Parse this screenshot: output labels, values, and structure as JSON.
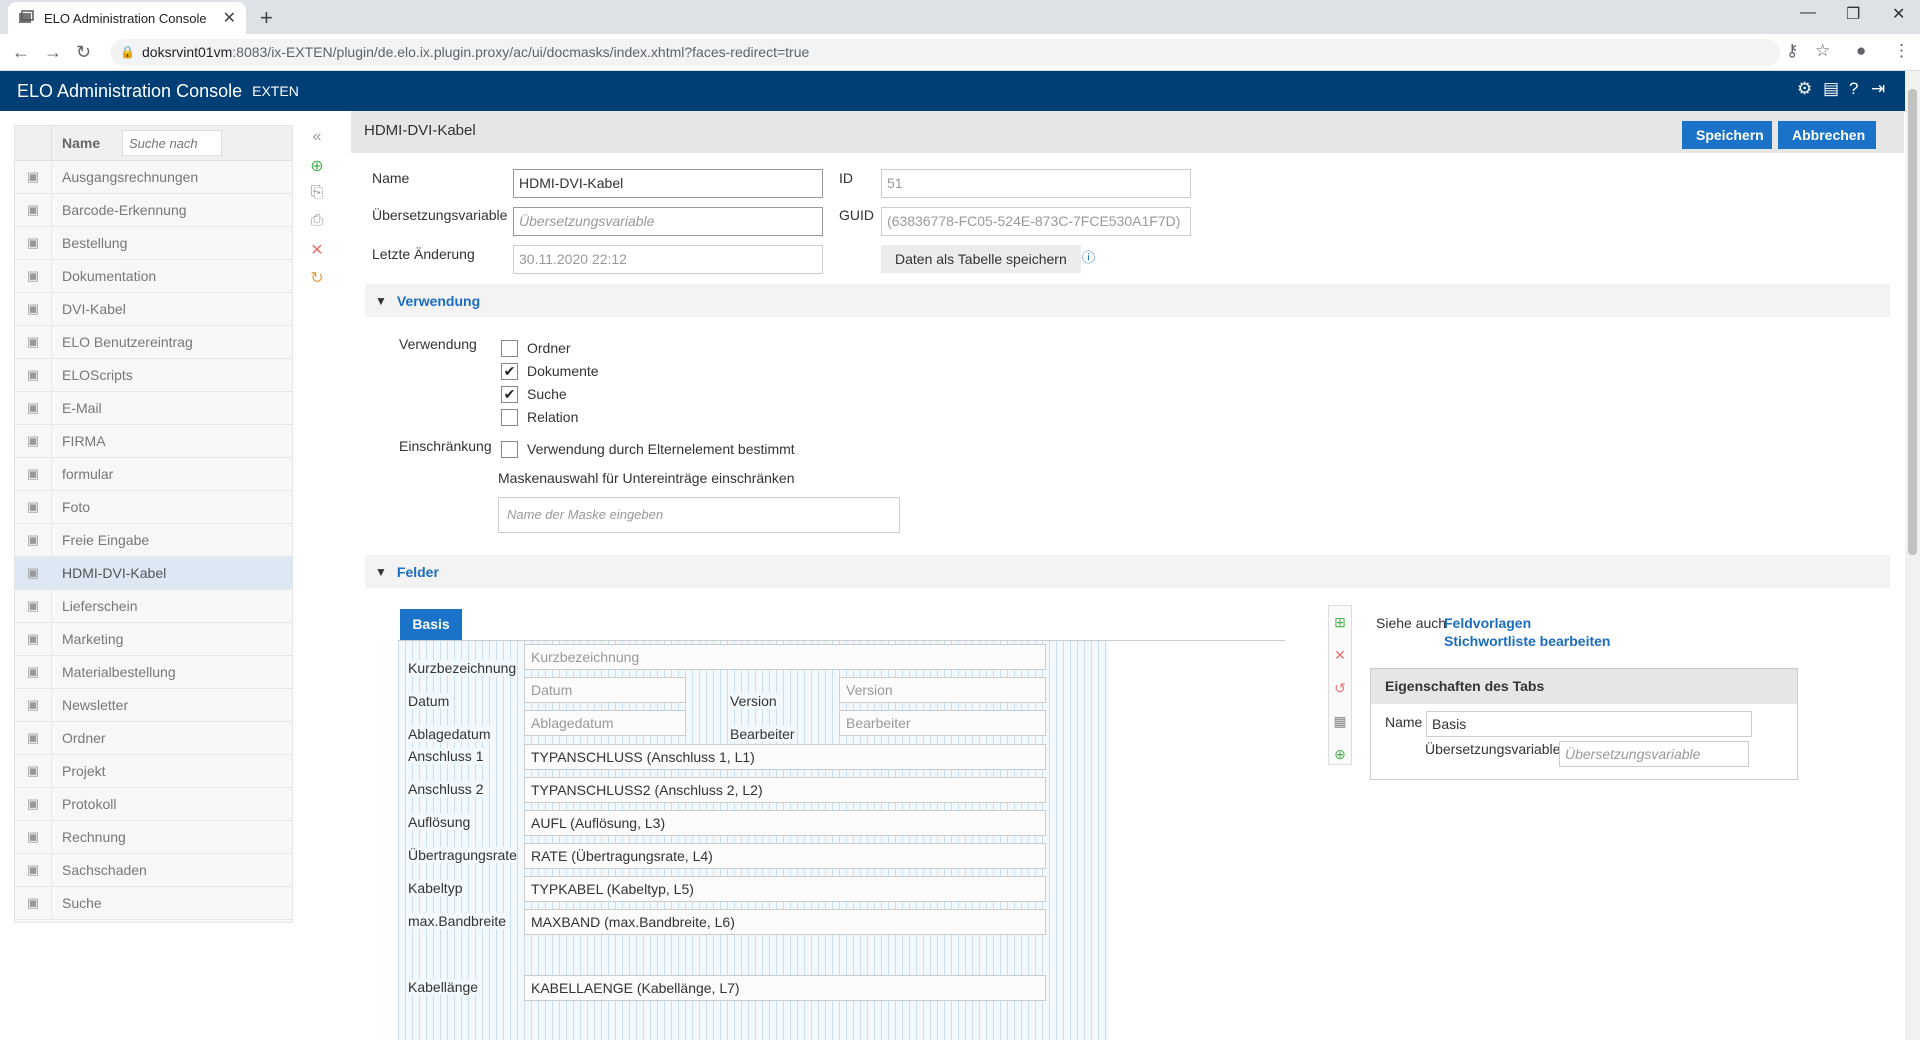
{
  "browser": {
    "tab_title": "ELO Administration Console",
    "url_host": "doksrvint01vm",
    "url_rest": ":8083/ix-EXTEN/plugin/de.elo.ix.plugin.proxy/ac/ui/docmasks/index.xhtml?faces-redirect=true"
  },
  "header": {
    "title": "ELO Administration Console",
    "tenant": "EXTEN"
  },
  "sidebar": {
    "col_name": "Name",
    "search_placeholder": "Suche nach",
    "items": [
      "Ausgangsrechnungen",
      "Barcode-Erkennung",
      "Bestellung",
      "Dokumentation",
      "DVI-Kabel",
      "ELO Benutzereintrag",
      "ELOScripts",
      "E-Mail",
      "FIRMA",
      "formular",
      "Foto",
      "Freie Eingabe",
      "HDMI-DVI-Kabel",
      "Lieferschein",
      "Marketing",
      "Materialbestellung",
      "Newsletter",
      "Ordner",
      "Projekt",
      "Protokoll",
      "Rechnung",
      "Sachschaden",
      "Suche"
    ],
    "selected": "HDMI-DVI-Kabel"
  },
  "main": {
    "title": "HDMI-DVI-Kabel",
    "save": "Speichern",
    "cancel": "Abbrechen",
    "name_label": "Name",
    "name_value": "HDMI-DVI-Kabel",
    "trans_label": "Übersetzungsvariable",
    "trans_placeholder": "Übersetzungsvariable",
    "changed_label": "Letzte Änderung",
    "changed_value": "30.11.2020 22:12",
    "id_label": "ID",
    "id_value": "51",
    "guid_label": "GUID",
    "guid_value": "(63836778-FC05-524E-873C-7FCE530A1F7D)",
    "table_btn": "Daten als Tabelle speichern"
  },
  "verwendung": {
    "section": "Verwendung",
    "label": "Verwendung",
    "options": [
      {
        "label": "Ordner",
        "checked": false
      },
      {
        "label": "Dokumente",
        "checked": true
      },
      {
        "label": "Suche",
        "checked": true
      },
      {
        "label": "Relation",
        "checked": false
      }
    ],
    "restrict_label": "Einschränkung",
    "restrict_option": "Verwendung durch Elternelement bestimmt",
    "mask_label": "Maskenauswahl für Untereinträge einschränken",
    "mask_placeholder": "Name der Maske eingeben"
  },
  "felder": {
    "section": "Felder",
    "tab": "Basis",
    "fields": [
      {
        "label": "Kurzbezeichnung",
        "value": "Kurzbezeichnung",
        "placeholder": true
      },
      {
        "label": "Datum",
        "value": "Datum",
        "placeholder": true,
        "label2": "Version",
        "value2": "Version"
      },
      {
        "label": "Ablagedatum",
        "value": "Ablagedatum",
        "placeholder": true,
        "label2": "Bearbeiter",
        "value2": "Bearbeiter"
      },
      {
        "label": "Anschluss 1",
        "value": "TYPANSCHLUSS (Anschluss 1, L1)"
      },
      {
        "label": "Anschluss 2",
        "value": "TYPANSCHLUSS2 (Anschluss 2, L2)"
      },
      {
        "label": "Auflösung",
        "value": "AUFL (Auflösung, L3)"
      },
      {
        "label": "Übertragungsrate",
        "value": "RATE (Übertragungsrate, L4)"
      },
      {
        "label": "Kabeltyp",
        "value": "TYPKABEL (Kabeltyp, L5)"
      },
      {
        "label": "max.Bandbreite",
        "value": "MAXBAND (max.Bandbreite, L6)"
      },
      {
        "label": "Kabellänge",
        "value": "KABELLAENGE (Kabellänge, L7)"
      }
    ],
    "see_also": "Siehe auch",
    "link1": "Feldvorlagen",
    "link2": "Stichwortliste bearbeiten",
    "props_title": "Eigenschaften des Tabs",
    "props_name_label": "Name",
    "props_name_value": "Basis",
    "props_trans_label": "Übersetzungsvariable",
    "props_trans_placeholder": "Übersetzungsvariable"
  }
}
